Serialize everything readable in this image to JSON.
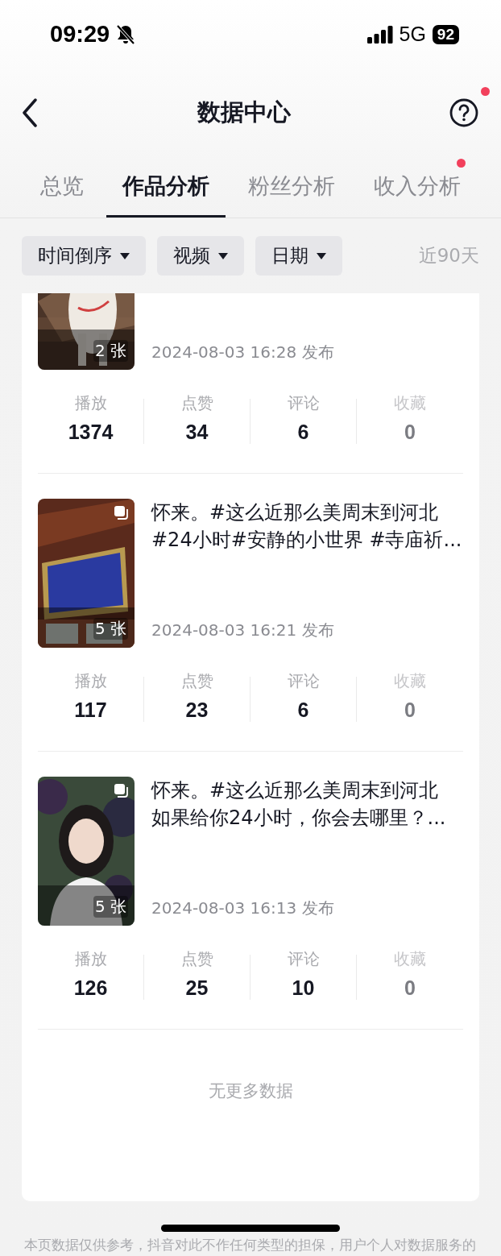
{
  "status_bar": {
    "time": "09:29",
    "network": "5G",
    "battery": "92"
  },
  "header": {
    "title": "数据中心",
    "help_badge": true
  },
  "tabs": [
    {
      "label": "总览",
      "selected": false,
      "badge": false
    },
    {
      "label": "作品分析",
      "selected": true,
      "badge": false
    },
    {
      "label": "粉丝分析",
      "selected": false,
      "badge": false
    },
    {
      "label": "收入分析",
      "selected": false,
      "badge": true
    }
  ],
  "filters": [
    {
      "label": "时间倒序"
    },
    {
      "label": "视频"
    },
    {
      "label": "日期"
    }
  ],
  "range": "近90天",
  "works": [
    {
      "photo_count": "2 张",
      "multi_icon": false,
      "date": "2024-08-03 16:28 发布",
      "stats": [
        {
          "label": "播放",
          "value": "1374",
          "disabled": false
        },
        {
          "label": "点赞",
          "value": "34",
          "disabled": false
        },
        {
          "label": "评论",
          "value": "6",
          "disabled": false
        },
        {
          "label": "收藏",
          "value": "0",
          "disabled": true
        }
      ]
    },
    {
      "title_lines": [
        "怀来。#这么近那么美周末到河北",
        "#24小时#安静的小世界 #寺庙祈..."
      ],
      "photo_count": "5 张",
      "multi_icon": true,
      "date": "2024-08-03 16:21 发布",
      "stats": [
        {
          "label": "播放",
          "value": "117",
          "disabled": false
        },
        {
          "label": "点赞",
          "value": "23",
          "disabled": false
        },
        {
          "label": "评论",
          "value": "6",
          "disabled": false
        },
        {
          "label": "收藏",
          "value": "0",
          "disabled": true
        }
      ]
    },
    {
      "title_lines": [
        "怀来。#这么近那么美周末到河北",
        "如果给你24小时，你会去哪里？..."
      ],
      "photo_count": "5 张",
      "multi_icon": true,
      "date": "2024-08-03 16:13 发布",
      "stats": [
        {
          "label": "播放",
          "value": "126",
          "disabled": false
        },
        {
          "label": "点赞",
          "value": "25",
          "disabled": false
        },
        {
          "label": "评论",
          "value": "10",
          "disabled": false
        },
        {
          "label": "收藏",
          "value": "0",
          "disabled": true
        }
      ]
    }
  ],
  "end_text": "无更多数据",
  "disclaimer": "本页数据仅供参考，抖音对此不作任何类型的担保，用户个人对数据服务的"
}
